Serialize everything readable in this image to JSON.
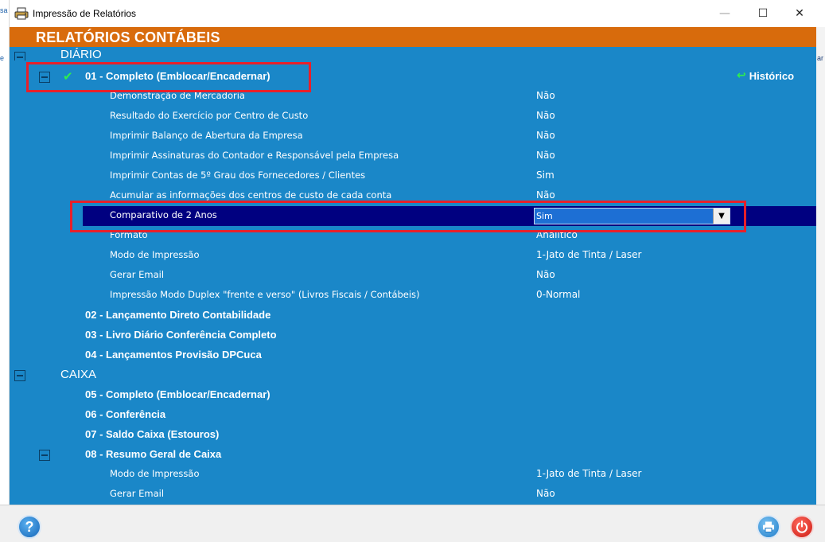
{
  "window": {
    "title": "Impressão de Relatórios",
    "min_glyph": "—",
    "max_glyph": "☐",
    "close_glyph": "✕"
  },
  "edge_stubs": {
    "left_top": "sa",
    "left_mid": "e",
    "right_mid": "ar"
  },
  "header": {
    "title": "RELATÓRIOS CONTÁBEIS"
  },
  "tree": {
    "historico_label": "Histórico",
    "historico_icon": "green-return-arrow",
    "check_icon": "✔",
    "diario": {
      "label": "DIÁRIO",
      "report01": {
        "label": "01 - Completo (Emblocar/Encadernar)",
        "options": [
          {
            "label": "Demonstração de Mercadoria",
            "value": "Não"
          },
          {
            "label": "Resultado do Exercício por Centro de Custo",
            "value": "Não"
          },
          {
            "label": "Imprimir Balanço de Abertura da Empresa",
            "value": "Não"
          },
          {
            "label": "Imprimir Assinaturas do Contador e Responsável pela Empresa",
            "value": "Não"
          },
          {
            "label": "Imprimir Contas de 5º Grau dos Fornecedores / Clientes",
            "value": "Sim"
          },
          {
            "label": "Acumular as informações dos centros de custo de cada conta",
            "value": "Não"
          },
          {
            "label": "Comparativo de 2 Anos",
            "value": "Sim"
          },
          {
            "label": "Formato",
            "value": "Analítico"
          },
          {
            "label": "Modo de Impressão",
            "value": "1-Jato de Tinta / Laser"
          },
          {
            "label": "Gerar Email",
            "value": "Não"
          },
          {
            "label": "Impressão Modo Duplex \"frente e verso\" (Livros Fiscais / Contábeis)",
            "value": "0-Normal"
          }
        ]
      },
      "reports": [
        "02 - Lançamento Direto Contabilidade",
        "03 - Livro Diário Conferência Completo",
        "04 - Lançamentos Provisão DPCuca"
      ]
    },
    "caixa": {
      "label": "CAIXA",
      "reports": [
        "05 - Completo (Emblocar/Encadernar)",
        "06 - Conferência",
        "07 - Saldo Caixa (Estouros)"
      ],
      "report08": {
        "label": "08 - Resumo Geral de Caixa",
        "options": [
          {
            "label": "Modo de Impressão",
            "value": "1-Jato de Tinta / Laser"
          },
          {
            "label": "Gerar Email",
            "value": "Não"
          }
        ]
      }
    }
  },
  "dropdown_arrow": "▼",
  "footer": {
    "help_glyph": "?",
    "print_glyph": "🖶",
    "power_glyph": "⏻"
  },
  "colors": {
    "header_orange": "#d86b0c",
    "tree_blue": "#1a87c8",
    "selected_navy": "#000080",
    "highlight_red": "#e8202a",
    "check_green": "#2eef4c"
  }
}
